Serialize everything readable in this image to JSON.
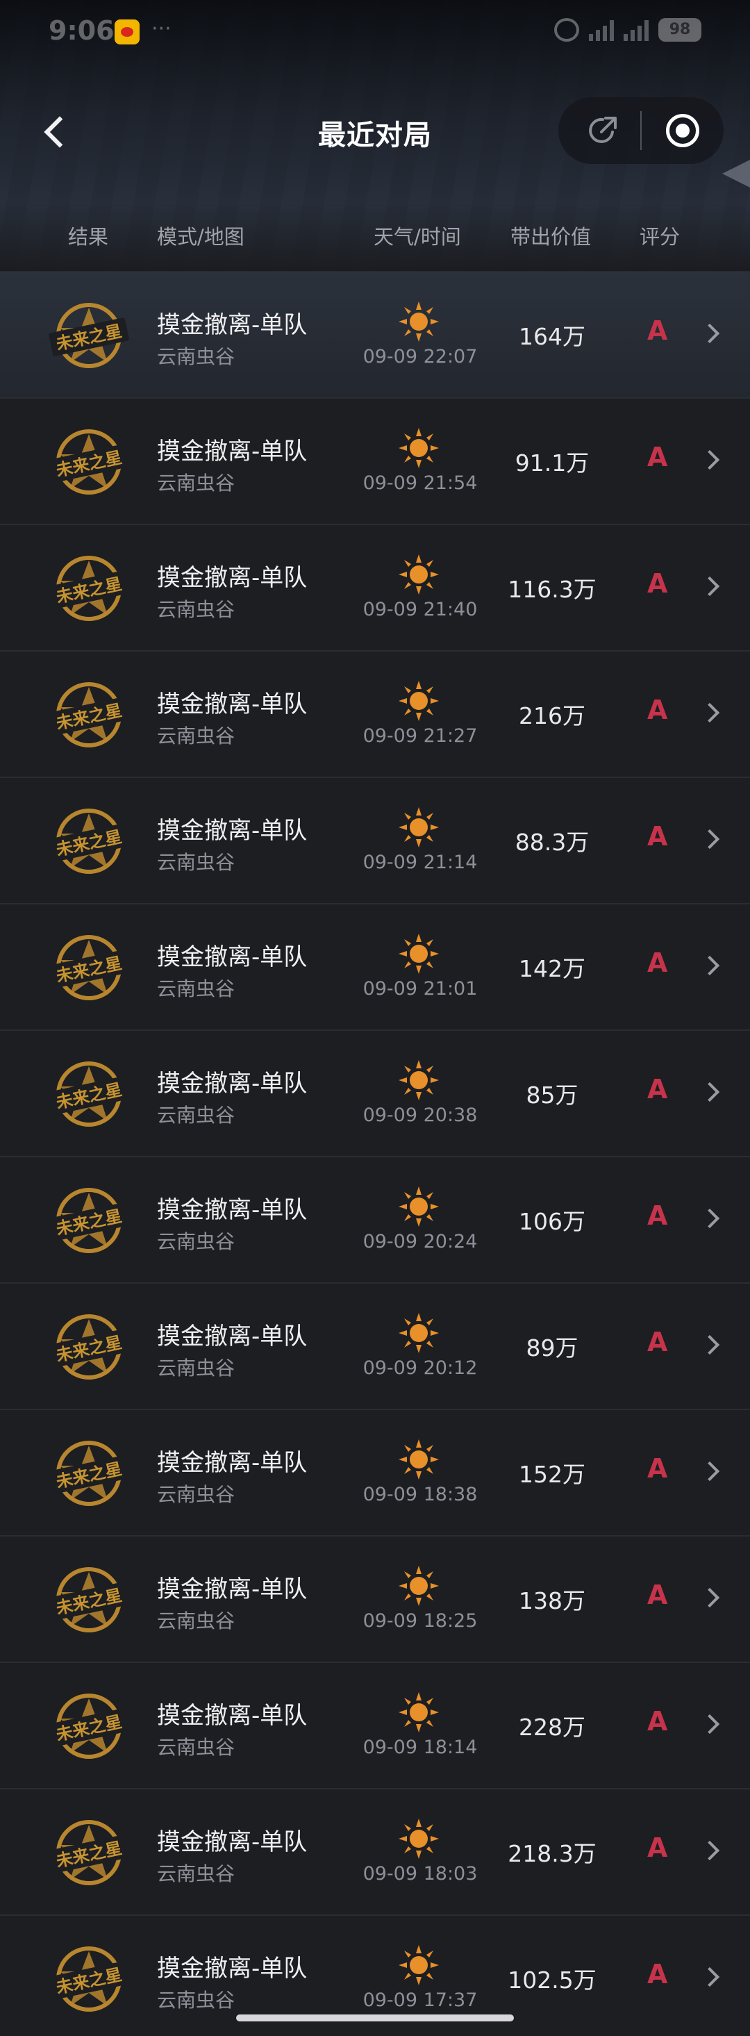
{
  "status_bar": {
    "time": "9:06",
    "dots": "···",
    "battery": "98"
  },
  "nav": {
    "title": "最近对局"
  },
  "columns": {
    "result": "结果",
    "mode_map": "模式/地图",
    "weather_time": "天气/时间",
    "value": "带出价值",
    "rating": "评分"
  },
  "badge_text": "未来之星",
  "colors": {
    "rating": "#c7334b",
    "badge": "#b8862e",
    "sun": "#e8902a"
  },
  "matches": [
    {
      "mode": "摸金撤离-单队",
      "map": "云南虫谷",
      "weather": "sun-icon",
      "time": "09-09 22:07",
      "value": "164万",
      "rating": "A"
    },
    {
      "mode": "摸金撤离-单队",
      "map": "云南虫谷",
      "weather": "sun-icon",
      "time": "09-09 21:54",
      "value": "91.1万",
      "rating": "A"
    },
    {
      "mode": "摸金撤离-单队",
      "map": "云南虫谷",
      "weather": "sun-icon",
      "time": "09-09 21:40",
      "value": "116.3万",
      "rating": "A"
    },
    {
      "mode": "摸金撤离-单队",
      "map": "云南虫谷",
      "weather": "sun-icon",
      "time": "09-09 21:27",
      "value": "216万",
      "rating": "A"
    },
    {
      "mode": "摸金撤离-单队",
      "map": "云南虫谷",
      "weather": "sun-icon",
      "time": "09-09 21:14",
      "value": "88.3万",
      "rating": "A"
    },
    {
      "mode": "摸金撤离-单队",
      "map": "云南虫谷",
      "weather": "sun-icon",
      "time": "09-09 21:01",
      "value": "142万",
      "rating": "A"
    },
    {
      "mode": "摸金撤离-单队",
      "map": "云南虫谷",
      "weather": "sun-icon",
      "time": "09-09 20:38",
      "value": "85万",
      "rating": "A"
    },
    {
      "mode": "摸金撤离-单队",
      "map": "云南虫谷",
      "weather": "sun-icon",
      "time": "09-09 20:24",
      "value": "106万",
      "rating": "A"
    },
    {
      "mode": "摸金撤离-单队",
      "map": "云南虫谷",
      "weather": "sun-icon",
      "time": "09-09 20:12",
      "value": "89万",
      "rating": "A"
    },
    {
      "mode": "摸金撤离-单队",
      "map": "云南虫谷",
      "weather": "sun-icon",
      "time": "09-09 18:38",
      "value": "152万",
      "rating": "A"
    },
    {
      "mode": "摸金撤离-单队",
      "map": "云南虫谷",
      "weather": "sun-icon",
      "time": "09-09 18:25",
      "value": "138万",
      "rating": "A"
    },
    {
      "mode": "摸金撤离-单队",
      "map": "云南虫谷",
      "weather": "sun-icon",
      "time": "09-09 18:14",
      "value": "228万",
      "rating": "A"
    },
    {
      "mode": "摸金撤离-单队",
      "map": "云南虫谷",
      "weather": "sun-icon",
      "time": "09-09 18:03",
      "value": "218.3万",
      "rating": "A"
    },
    {
      "mode": "摸金撤离-单队",
      "map": "云南虫谷",
      "weather": "sun-icon",
      "time": "09-09 17:37",
      "value": "102.5万",
      "rating": "A"
    }
  ]
}
